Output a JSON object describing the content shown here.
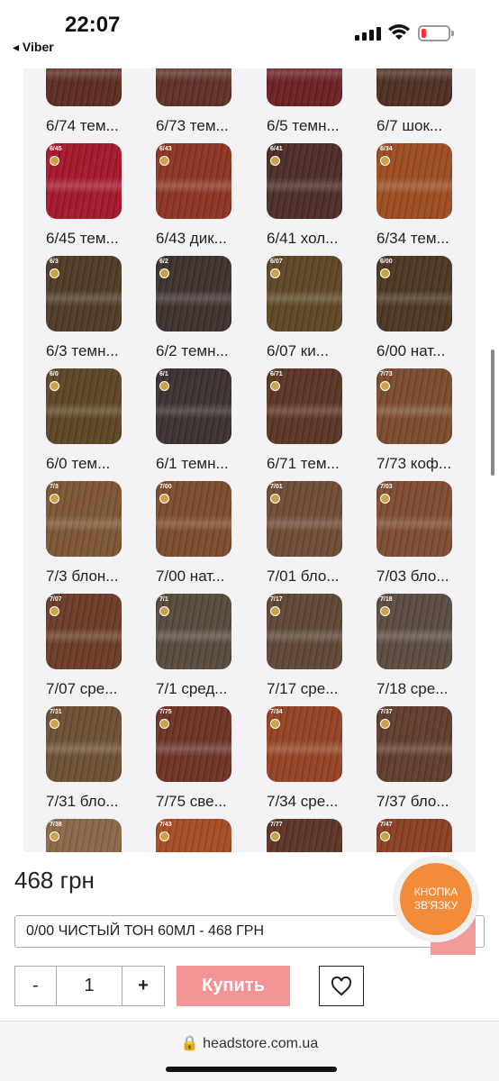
{
  "status_bar": {
    "time": "22:07",
    "back_label": "◂ Viber"
  },
  "swatches": [
    [
      {
        "label": "6/74 тем...",
        "color": "#5a2a1f",
        "badge": ""
      },
      {
        "label": "6/73 тем...",
        "color": "#5c2f26",
        "badge": ""
      },
      {
        "label": "6/5 темн...",
        "color": "#6a1f22",
        "badge": ""
      },
      {
        "label": "6/7 шок...",
        "color": "#4d2d22",
        "badge": ""
      }
    ],
    [
      {
        "label": "6/45 тем...",
        "color": "#a4172a",
        "badge": "6/45"
      },
      {
        "label": "6/43 дик...",
        "color": "#8c3321",
        "badge": "6/43"
      },
      {
        "label": "6/41 хол...",
        "color": "#4a2b26",
        "badge": "6/41"
      },
      {
        "label": "6/34 тем...",
        "color": "#9b4a1f",
        "badge": "6/34"
      }
    ],
    [
      {
        "label": "6/3 темн...",
        "color": "#4d3a25",
        "badge": "6/3"
      },
      {
        "label": "6/2 темн...",
        "color": "#3c302c",
        "badge": "6/2"
      },
      {
        "label": "6/07 ки...",
        "color": "#5d4524",
        "badge": "6/07"
      },
      {
        "label": "6/00 нат...",
        "color": "#4a3520",
        "badge": "6/00"
      }
    ],
    [
      {
        "label": "6/0 тем...",
        "color": "#5b4424",
        "badge": "6/0"
      },
      {
        "label": "6/1 темн...",
        "color": "#3b302d",
        "badge": "6/1"
      },
      {
        "label": "6/71 тем...",
        "color": "#5a3424",
        "badge": "6/71"
      },
      {
        "label": "7/73 коф...",
        "color": "#7a4a2c",
        "badge": "7/73"
      }
    ],
    [
      {
        "label": "7/3 блон...",
        "color": "#7b5432",
        "badge": "7/3"
      },
      {
        "label": "7/00 нат...",
        "color": "#7b4a2a",
        "badge": "7/00"
      },
      {
        "label": "7/01 бло...",
        "color": "#6e4a33",
        "badge": "7/01"
      },
      {
        "label": "7/03 бло...",
        "color": "#7d4a30",
        "badge": "7/03"
      }
    ],
    [
      {
        "label": "7/07 сре...",
        "color": "#6a3a26",
        "badge": "7/07"
      },
      {
        "label": "7/1 сред...",
        "color": "#56493c",
        "badge": "7/1"
      },
      {
        "label": "7/17 сре...",
        "color": "#5d4535",
        "badge": "7/17"
      },
      {
        "label": "7/18 сре...",
        "color": "#5a4a40",
        "badge": "7/18"
      }
    ],
    [
      {
        "label": "7/31 бло...",
        "color": "#6b4e33",
        "badge": "7/31"
      },
      {
        "label": "7/75 све...",
        "color": "#6b3224",
        "badge": "7/75"
      },
      {
        "label": "7/34 сре...",
        "color": "#944122",
        "badge": "7/34"
      },
      {
        "label": "7/37 бло...",
        "color": "#5e3c2a",
        "badge": "7/37"
      }
    ],
    [
      {
        "label": "",
        "color": "#8a6646",
        "badge": "7/38"
      },
      {
        "label": "",
        "color": "#a44a22",
        "badge": "7/43"
      },
      {
        "label": "",
        "color": "#5c3324",
        "badge": "7/77"
      },
      {
        "label": "",
        "color": "#8a3e22",
        "badge": "7/47"
      }
    ]
  ],
  "product": {
    "price": "468 грн",
    "selected_option": "0/00 ЧИСТЫЙ ТОН 60МЛ - 468 ГРН",
    "quantity": "1",
    "minus_label": "-",
    "plus_label": "+",
    "buy_label": "Купить",
    "contact_label": "КНОПКА ЗВ'ЯЗКУ"
  },
  "browser": {
    "url": "headstore.com.ua"
  }
}
